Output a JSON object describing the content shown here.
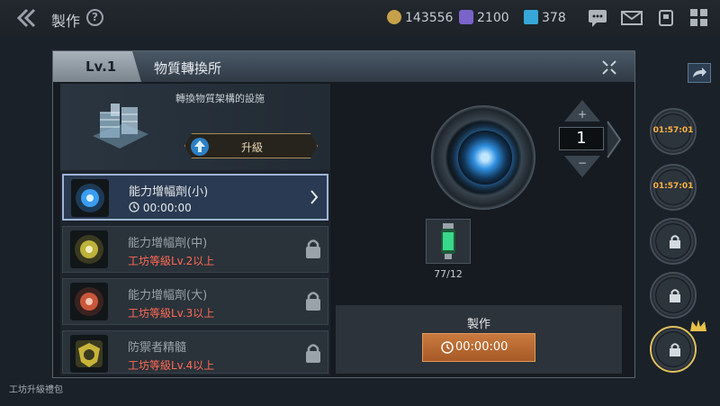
{
  "topbar": {
    "title": "製作",
    "help": "?",
    "gold": "143556",
    "crystal": "2100",
    "gem": "378"
  },
  "side_slots": [
    {
      "time": "01:57:01"
    },
    {
      "time": "01:57:01"
    },
    {
      "time": ""
    },
    {
      "time": ""
    },
    {
      "time": ""
    }
  ],
  "modal": {
    "level": "Lv.1",
    "title": "物質轉換所",
    "facility_desc": "轉換物質架構的設施",
    "upgrade_label": "升級",
    "items": [
      {
        "name": "能力增幅劑(小)",
        "time": "00:00:00"
      },
      {
        "name": "能力增幅劑(中)",
        "req": "工坊等級Lv.2以上"
      },
      {
        "name": "能力增幅劑(大)",
        "req": "工坊等級Lv.3以上"
      },
      {
        "name": "防禦者精髓",
        "req": "工坊等級Lv.4以上"
      }
    ],
    "quantity": "1",
    "inc": "+",
    "dec": "−",
    "material_count": "77/12",
    "craft_label": "製作",
    "craft_time": "00:00:00"
  },
  "bottom_left": "工坊升級禮包"
}
